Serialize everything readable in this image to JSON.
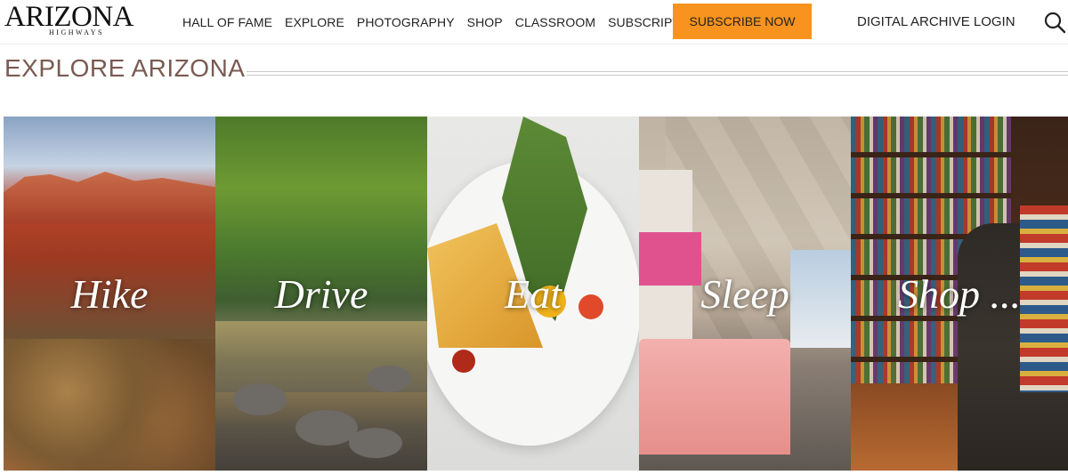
{
  "header": {
    "logo": {
      "title": "ARIZONA",
      "subtitle": "HIGHWAYS"
    },
    "nav": [
      {
        "label": "HALL OF FAME"
      },
      {
        "label": "EXPLORE"
      },
      {
        "label": "PHOTOGRAPHY"
      },
      {
        "label": "SHOP"
      },
      {
        "label": "CLASSROOM"
      },
      {
        "label": "SUBSCRIPTIONS"
      }
    ],
    "subscribe_label": "SUBSCRIBE NOW",
    "archive_label": "DIGITAL ARCHIVE LOGIN",
    "search_icon": "search-icon",
    "accent_color": "#f7931e"
  },
  "section": {
    "title": "EXPLORE ARIZONA",
    "title_color": "#7a5a52"
  },
  "tiles": [
    {
      "label": "Hike",
      "icon": "canyon-photo"
    },
    {
      "label": "Drive",
      "icon": "creek-photo"
    },
    {
      "label": "Eat",
      "icon": "food-photo"
    },
    {
      "label": "Sleep",
      "icon": "dome-bedroom-photo"
    },
    {
      "label": "Shop ...",
      "icon": "bookstore-photo"
    }
  ]
}
